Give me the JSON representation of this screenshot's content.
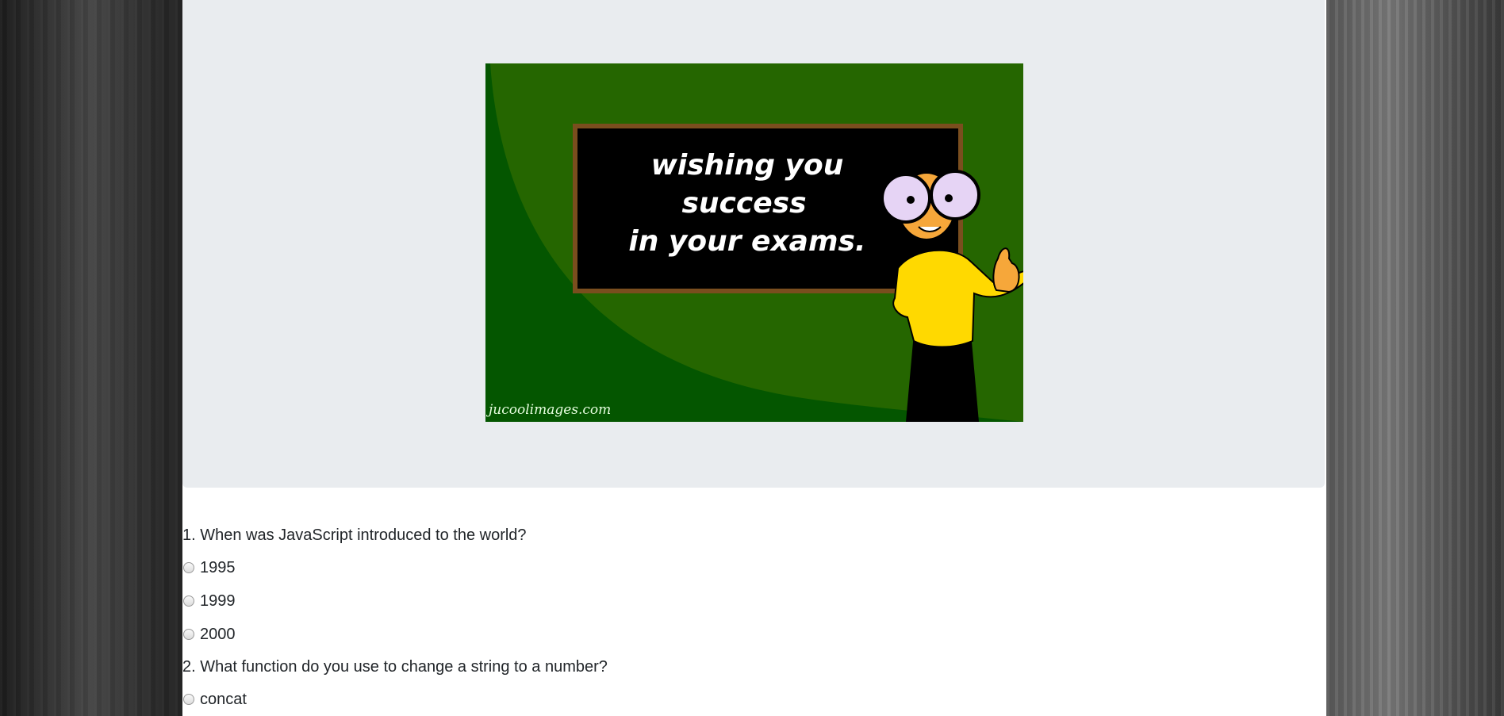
{
  "banner": {
    "chalkboard_lines": [
      "wishing you",
      "success",
      "in your exams."
    ],
    "watermark": "jucoolimages.com"
  },
  "quiz": {
    "questions": [
      {
        "text": "1. When was JavaScript introduced to the world?",
        "options": [
          "1995",
          "1999",
          "2000"
        ]
      },
      {
        "text": "2. What function do you use to change a string to a number?",
        "options": [
          "concat"
        ]
      }
    ]
  }
}
